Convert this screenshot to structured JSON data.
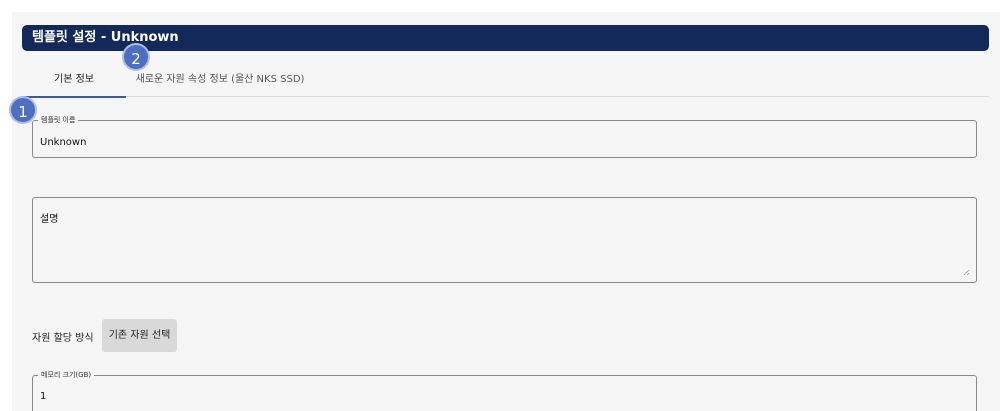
{
  "header": {
    "title": "템플릿 설정 - Unknown"
  },
  "tabs": [
    {
      "label": "기본 정보",
      "active": true
    },
    {
      "label": "새로운 자원 속성 정보 (울산 NKS SSD)",
      "active": false
    }
  ],
  "badges": [
    "1",
    "2"
  ],
  "form": {
    "template_name": {
      "legend": "템플릿 이름",
      "value": "Unknown"
    },
    "description": {
      "placeholder": "설명",
      "value": ""
    },
    "allocation": {
      "label": "자원 할당 방식",
      "button_label": "기존 자원 선택"
    },
    "memory": {
      "legend": "메모리 크기(GB)",
      "value": "1"
    }
  },
  "colors": {
    "title_bar": "#12295a",
    "badge": "#4d6fc1",
    "active_tab_underline": "#3a5aa8"
  }
}
